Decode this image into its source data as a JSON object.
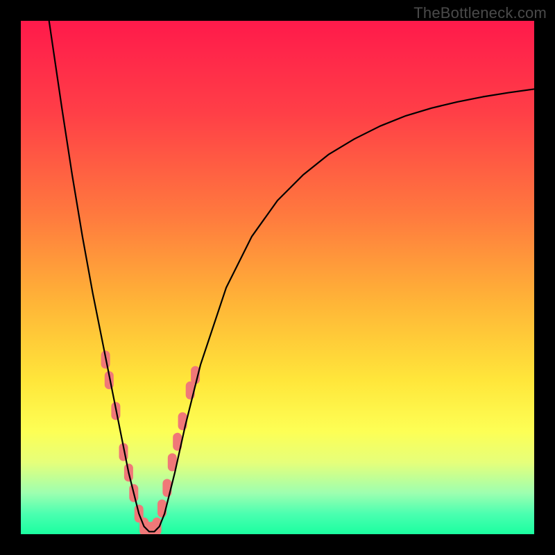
{
  "watermark": "TheBottleneck.com",
  "chart_data": {
    "type": "line",
    "title": "",
    "xlabel": "",
    "ylabel": "",
    "xlim": [
      0,
      100
    ],
    "ylim": [
      0,
      100
    ],
    "background_gradient_stops": [
      {
        "offset": 0.0,
        "color": "#ff1a4b"
      },
      {
        "offset": 0.18,
        "color": "#ff3f47"
      },
      {
        "offset": 0.38,
        "color": "#ff7a3e"
      },
      {
        "offset": 0.55,
        "color": "#ffb537"
      },
      {
        "offset": 0.7,
        "color": "#ffe63a"
      },
      {
        "offset": 0.8,
        "color": "#fdff55"
      },
      {
        "offset": 0.86,
        "color": "#e6ff7a"
      },
      {
        "offset": 0.92,
        "color": "#9dffb0"
      },
      {
        "offset": 0.96,
        "color": "#4bffb0"
      },
      {
        "offset": 1.0,
        "color": "#1bffa0"
      }
    ],
    "series": [
      {
        "name": "curve",
        "color": "#000000",
        "x": [
          5.5,
          8,
          10,
          12,
          14,
          16,
          17,
          18,
          19,
          20,
          21,
          22,
          23,
          24,
          25,
          26,
          27,
          28,
          29,
          30,
          32,
          35,
          40,
          45,
          50,
          55,
          60,
          65,
          70,
          75,
          80,
          85,
          90,
          95,
          100
        ],
        "values": [
          100,
          83,
          70,
          58,
          47,
          37,
          32,
          27,
          22,
          17,
          12,
          8,
          4,
          1.5,
          0.5,
          0.5,
          1.5,
          4,
          8,
          12,
          21,
          33,
          48,
          58,
          65,
          70,
          74,
          77,
          79.5,
          81.5,
          83,
          84.2,
          85.2,
          86,
          86.7
        ]
      }
    ],
    "markers": {
      "color": "#f07878",
      "points": [
        {
          "x": 16.5,
          "y": 34
        },
        {
          "x": 17.2,
          "y": 30
        },
        {
          "x": 18.5,
          "y": 24
        },
        {
          "x": 20.0,
          "y": 16
        },
        {
          "x": 21.0,
          "y": 12
        },
        {
          "x": 22.0,
          "y": 8
        },
        {
          "x": 23.0,
          "y": 4
        },
        {
          "x": 24.0,
          "y": 1.5
        },
        {
          "x": 24.8,
          "y": 0.7
        },
        {
          "x": 25.6,
          "y": 0.7
        },
        {
          "x": 26.5,
          "y": 1.5
        },
        {
          "x": 27.5,
          "y": 5
        },
        {
          "x": 28.5,
          "y": 9
        },
        {
          "x": 29.5,
          "y": 14
        },
        {
          "x": 30.5,
          "y": 18
        },
        {
          "x": 31.5,
          "y": 22
        },
        {
          "x": 33.0,
          "y": 28
        },
        {
          "x": 34.0,
          "y": 31
        }
      ]
    }
  }
}
